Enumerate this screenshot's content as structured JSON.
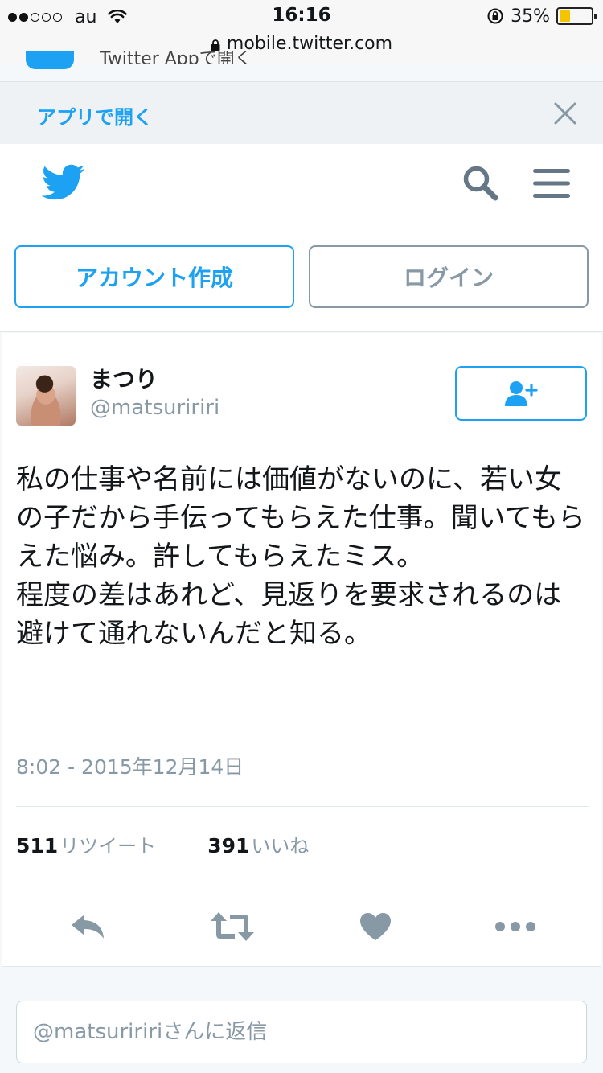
{
  "status_bar": {
    "carrier": "au",
    "time": "16:16",
    "battery": "35%",
    "battery_level": 0.35,
    "url": "mobile.twitter.com"
  },
  "top_peek": {
    "text": "Twitter Appで開く"
  },
  "app_banner": {
    "link": "アプリで開く",
    "close_icon": "close-icon"
  },
  "header": {
    "logo_icon": "twitter-bird-icon",
    "search_icon": "search-icon",
    "menu_icon": "hamburger-menu-icon",
    "signup_label": "アカウント作成",
    "login_label": "ログイン"
  },
  "tweet": {
    "display_name": "まつり",
    "handle": "@matsuririri",
    "follow_icon": "follow-user-icon",
    "text": "私の仕事や名前には価値がないのに、若い女の子だから手伝ってもらえた仕事。聞いてもらえた悩み。許してもらえたミス。\n程度の差はあれど、見返りを要求されるのは避けて通れないんだと知る。",
    "timestamp": "8:02 - 2015年12月14日",
    "retweet_count": "511",
    "retweet_label": "リツイート",
    "like_count": "391",
    "like_label": "いいね",
    "actions": [
      "reply-icon",
      "retweet-icon",
      "heart-icon",
      "more-icon"
    ]
  },
  "reply": {
    "placeholder": "@matsuriririさんに返信"
  },
  "colors": {
    "accent": "#1da1f2",
    "muted": "#8899a6",
    "text": "#14171a",
    "background": "#f5f8fa"
  }
}
